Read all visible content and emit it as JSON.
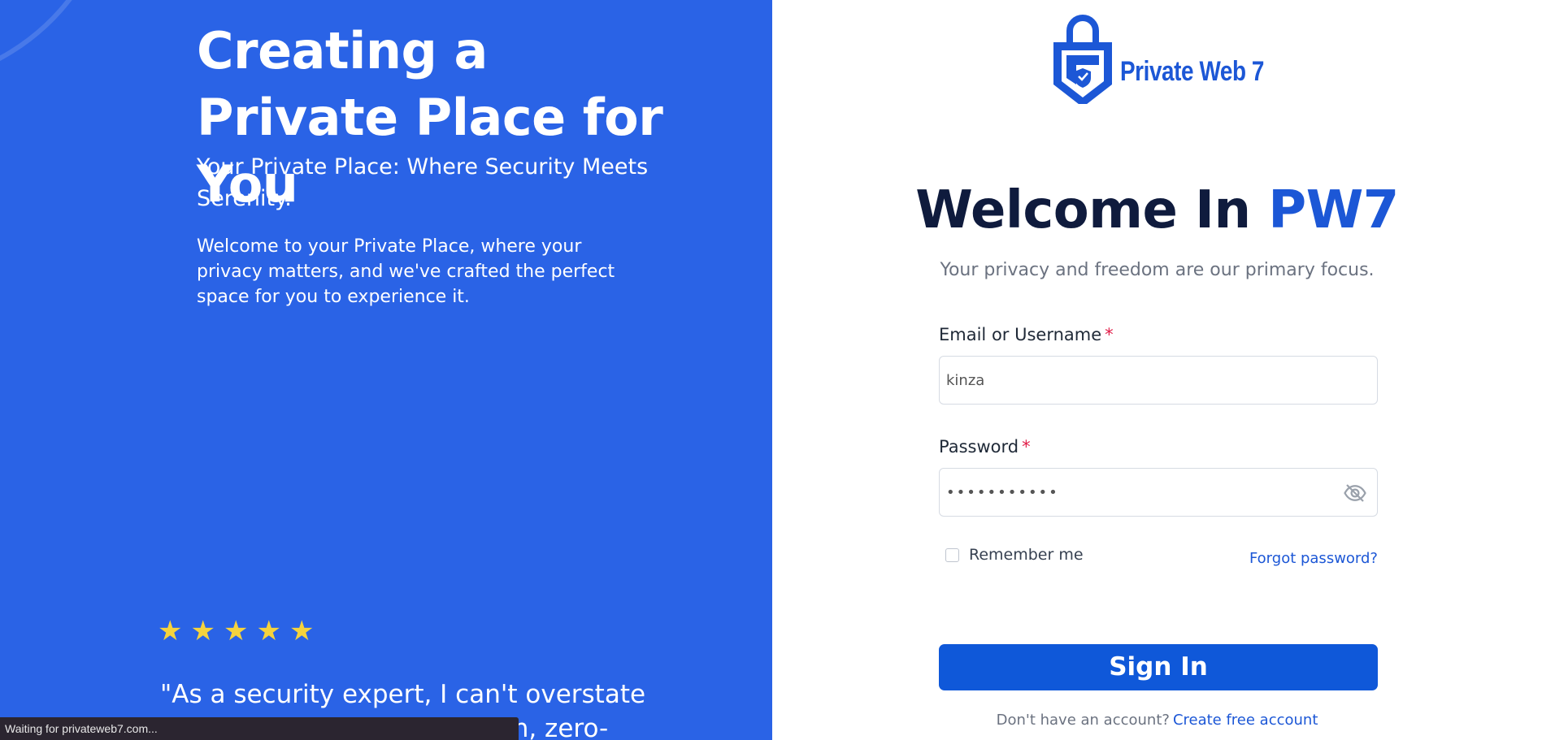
{
  "hero": {
    "title": "Creating a Private Place for You",
    "subtitle": "Your Private Place: Where Security Meets Serenity.",
    "body": "Welcome to your Private Place, where your privacy matters, and we've crafted the perfect space for you to experience it.",
    "rating": 5,
    "star_glyph": "★",
    "quote": "\"As a security expert, I can't overstate the importance of encryption, zero-"
  },
  "status_bar": {
    "text": "Waiting for privateweb7.com..."
  },
  "brand": {
    "name": "Private Web 7",
    "icon": "padlock-shield-icon"
  },
  "welcome": {
    "prefix": "Welcome In ",
    "accent": "PW7",
    "tagline": "Your privacy and freedom are our primary focus."
  },
  "form": {
    "email_label": "Email or Username",
    "email_value": "kinza",
    "password_label": "Password",
    "password_masked": "•••••••••••",
    "required_mark": "*",
    "remember_label": "Remember me",
    "remember_checked": false,
    "forgot_label": "Forgot password?",
    "signin_label": "Sign In",
    "no_account_text": "Don't have an account?",
    "create_account_label": "Create free account"
  },
  "colors": {
    "left_bg": "#2a63e6",
    "accent": "#1c57d6",
    "button": "#0f58d9",
    "star": "#f5d33d",
    "heading": "#0f1b3d"
  }
}
